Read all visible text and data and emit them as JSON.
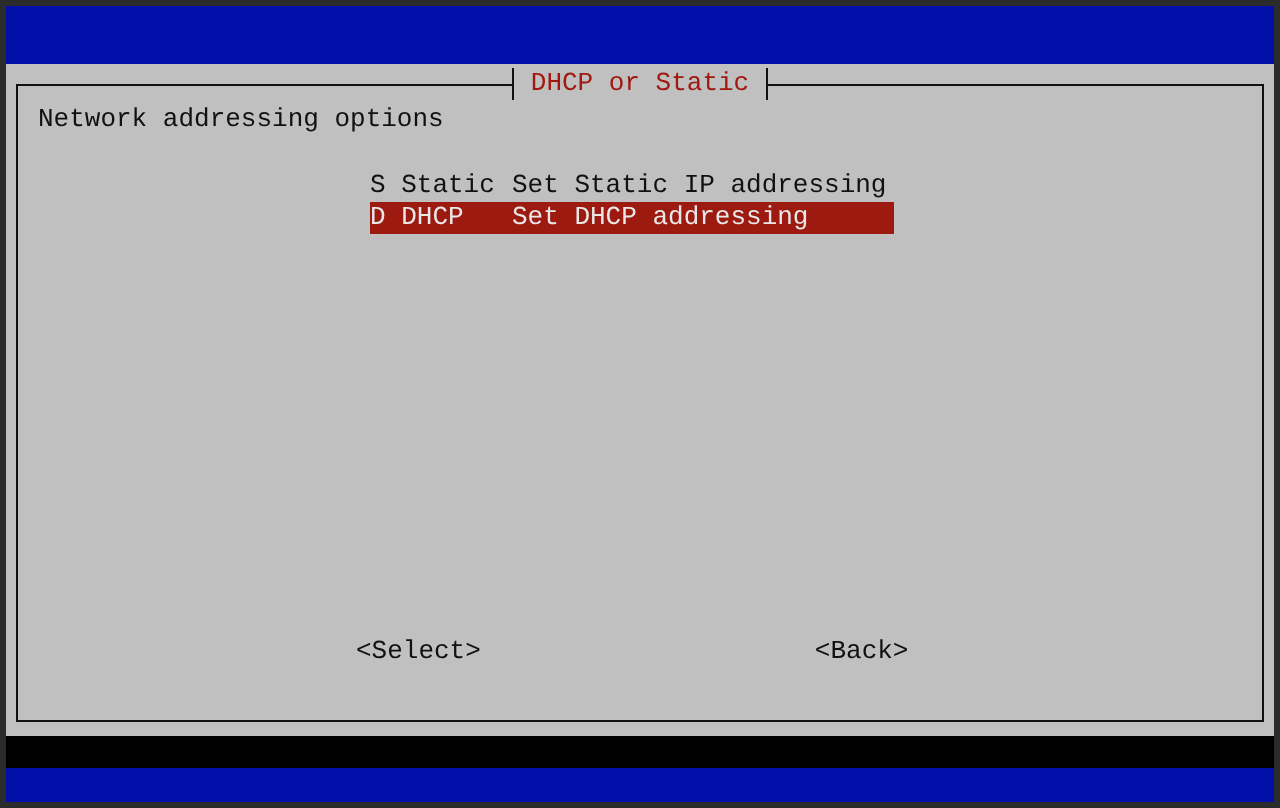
{
  "dialog": {
    "title": "DHCP or Static",
    "prompt": "Network addressing options",
    "menu": [
      {
        "tag": "S Static",
        "description": "Set Static IP addressing",
        "selected": false
      },
      {
        "tag": "D DHCP",
        "description": "Set DHCP addressing",
        "selected": true
      }
    ],
    "buttons": [
      "<Select>",
      "<Back>"
    ]
  }
}
